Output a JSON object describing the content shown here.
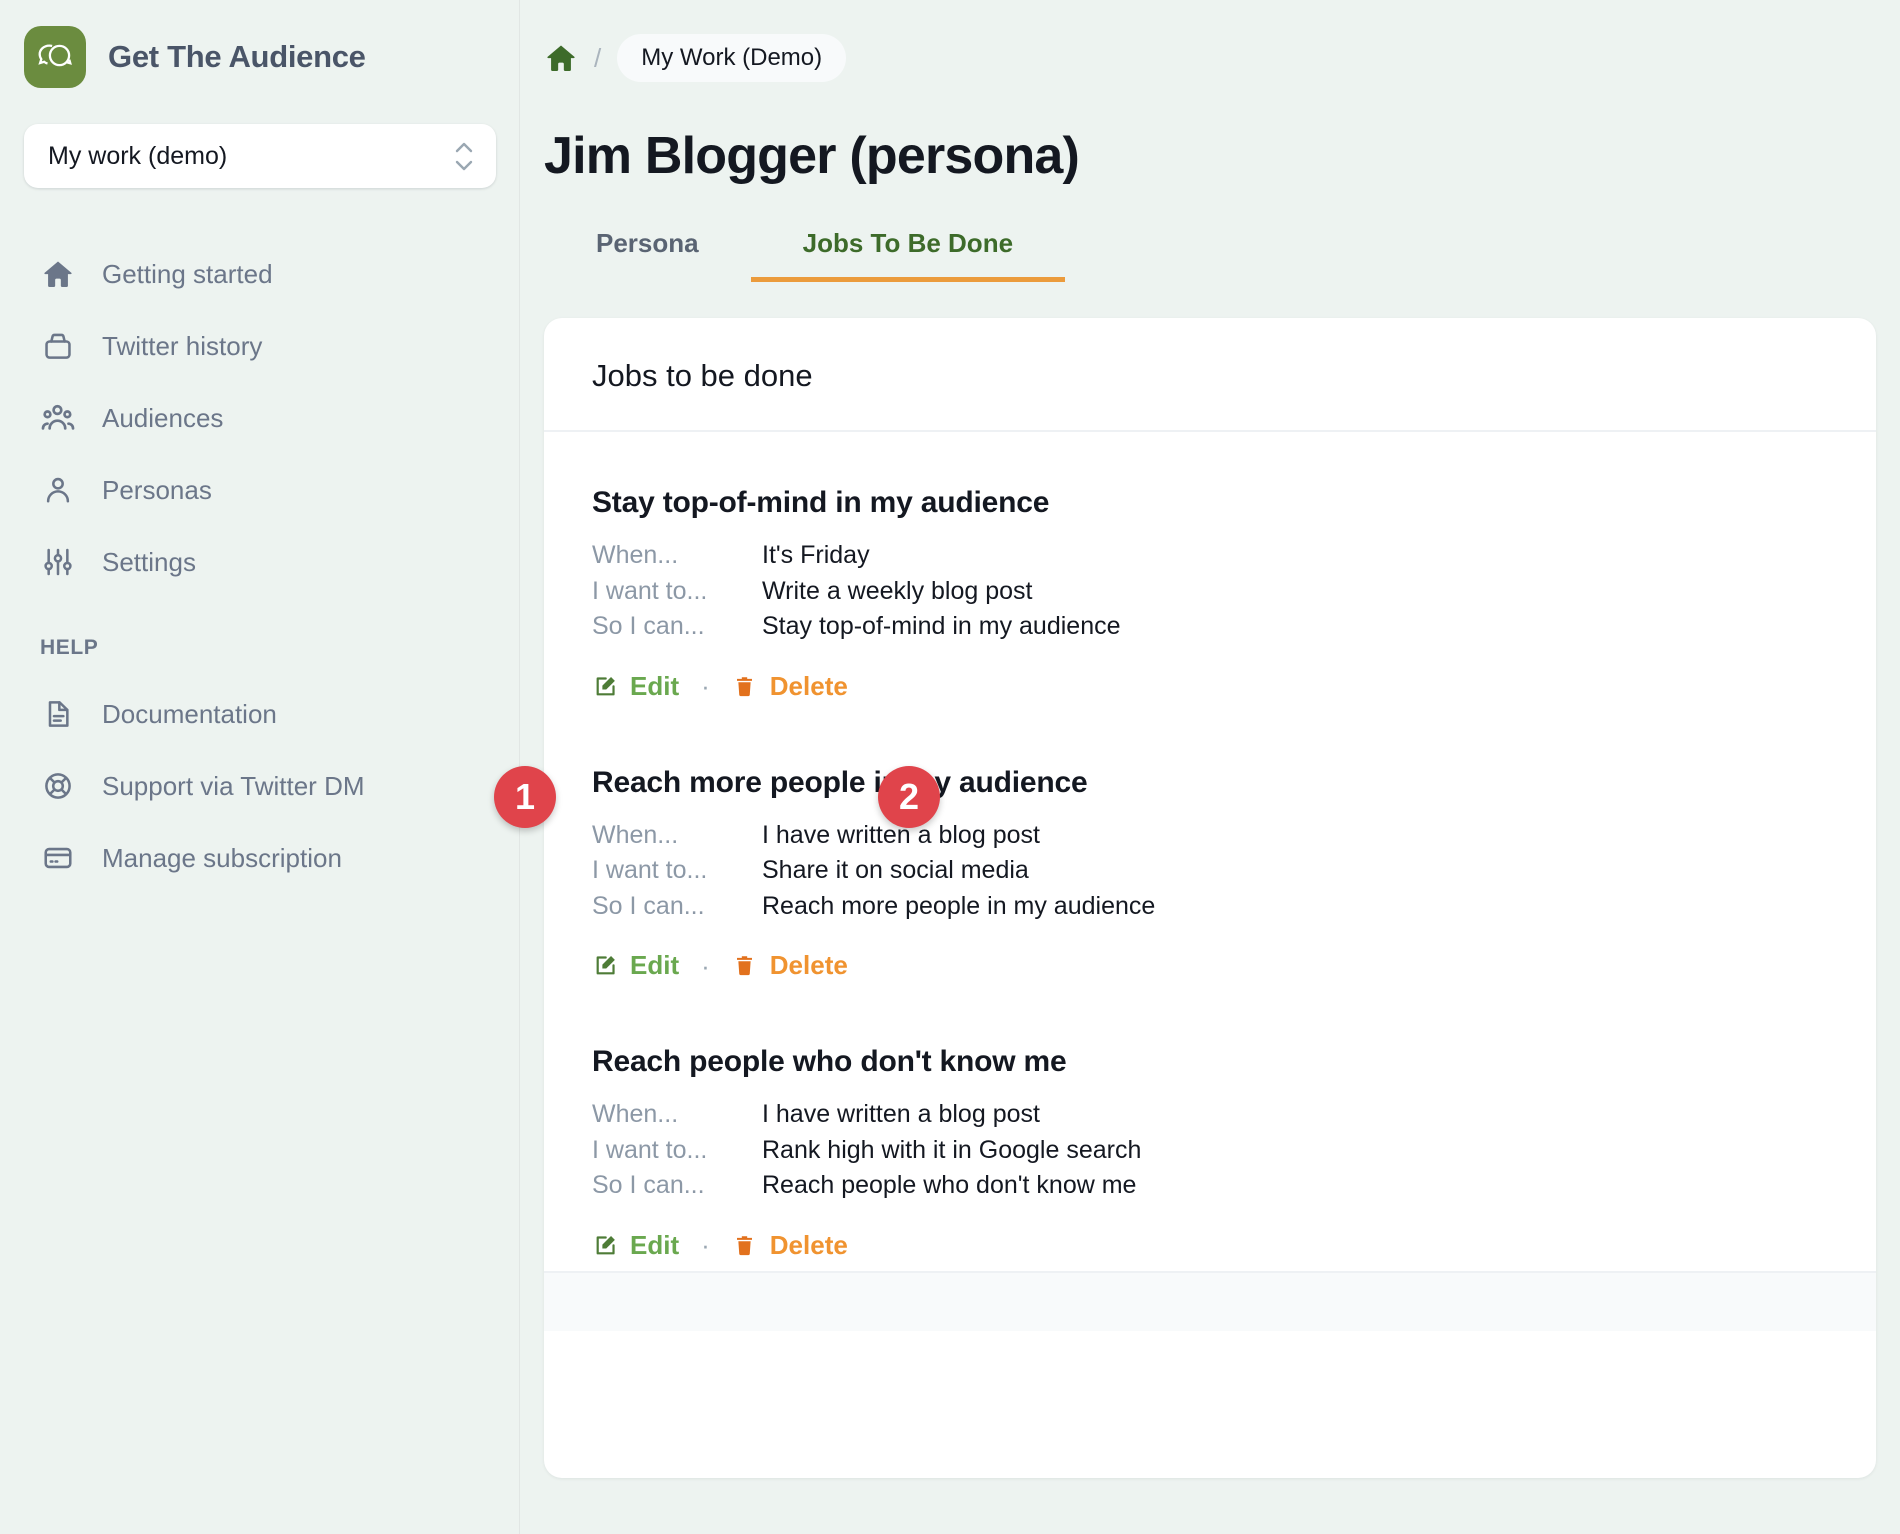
{
  "brand": {
    "name": "Get The Audience",
    "logo_icon": "chat-bubbles-icon",
    "logo_color": "#6b8c3f"
  },
  "workspace_selector": {
    "value": "My work (demo)",
    "icon": "chevron-up-down-icon"
  },
  "sidebar": {
    "items": [
      {
        "label": "Getting started",
        "icon": "home-icon"
      },
      {
        "label": "Twitter history",
        "icon": "archive-icon"
      },
      {
        "label": "Audiences",
        "icon": "users-group-icon"
      },
      {
        "label": "Personas",
        "icon": "user-icon"
      },
      {
        "label": "Settings",
        "icon": "sliders-icon"
      }
    ],
    "help_section_title": "HELP",
    "help_items": [
      {
        "label": "Documentation",
        "icon": "document-icon"
      },
      {
        "label": "Support via Twitter DM",
        "icon": "lifebuoy-icon"
      },
      {
        "label": "Manage subscription",
        "icon": "credit-card-icon"
      }
    ]
  },
  "breadcrumb": {
    "home_icon": "home-icon",
    "separator": "/",
    "chip_label": "My Work (Demo)"
  },
  "page": {
    "title": "Jim Blogger (persona)"
  },
  "tabs": [
    {
      "label": "Persona",
      "active": false
    },
    {
      "label": "Jobs To Be Done",
      "active": true
    }
  ],
  "tab_accent_color": "#eb9b3c",
  "card": {
    "header_title": "Jobs to be done",
    "row_labels": {
      "when": "When...",
      "i_want_to": "I want to...",
      "so_i_can": "So I can..."
    },
    "actions": {
      "edit_label": "Edit",
      "edit_icon": "pencil-square-icon",
      "edit_color": "#6aa84f",
      "delete_label": "Delete",
      "delete_icon": "trash-icon",
      "delete_color": "#f09330",
      "separator": "·"
    },
    "jobs": [
      {
        "title": "Stay top-of-mind in my audience",
        "when": "It's Friday",
        "i_want_to": "Write a weekly blog post",
        "so_i_can": "Stay top-of-mind in my audience"
      },
      {
        "title": "Reach more people in my audience",
        "when": "I have written a blog post",
        "i_want_to": "Share it on social media",
        "so_i_can": "Reach more people in my audience"
      },
      {
        "title": "Reach people who don't know me",
        "when": "I have written a blog post",
        "i_want_to": "Rank high with it in Google search",
        "so_i_can": "Reach people who don't know me"
      }
    ]
  },
  "annotations": {
    "badge_color": "#e0444b",
    "badges": [
      {
        "number": "1",
        "target": "edit-action"
      },
      {
        "number": "2",
        "target": "delete-action"
      }
    ]
  }
}
